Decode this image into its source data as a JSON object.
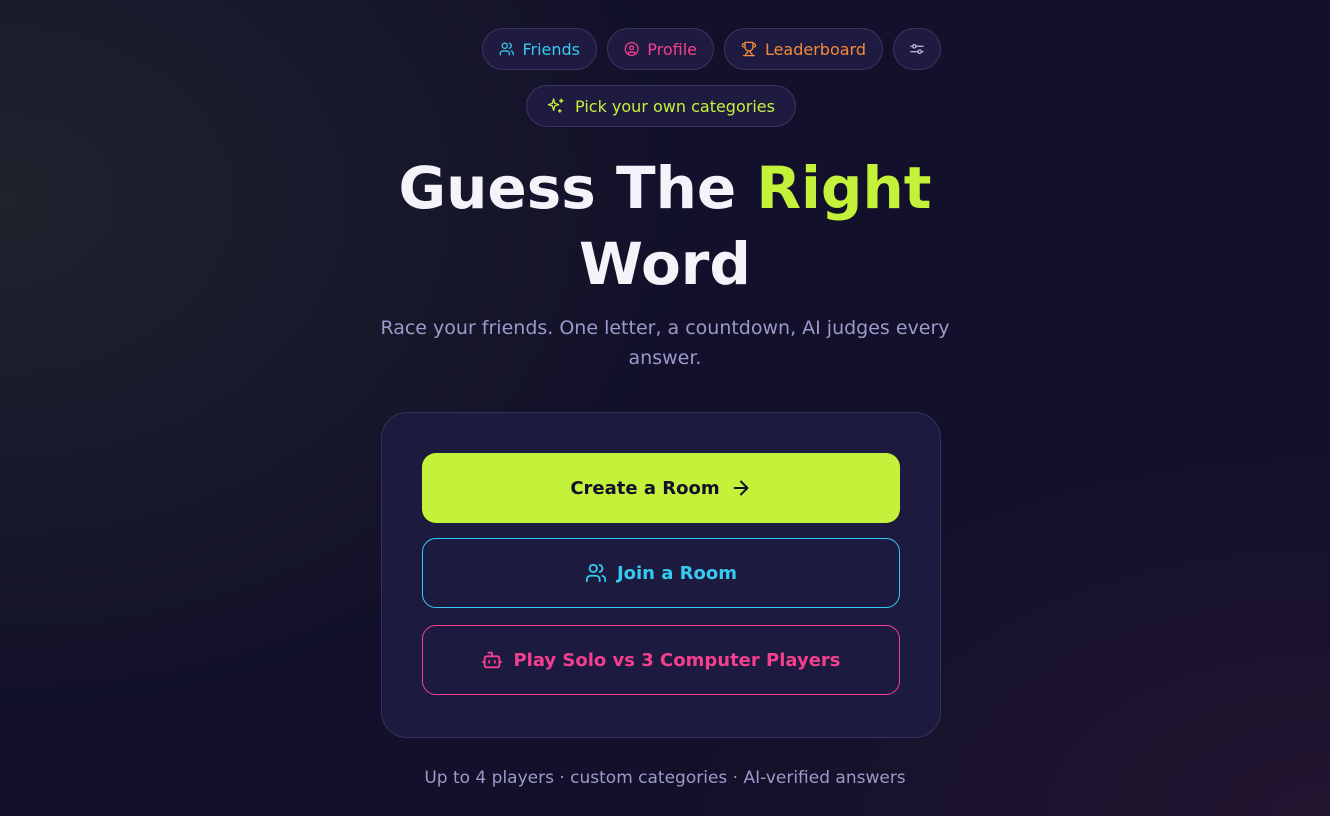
{
  "nav": {
    "friends_label": "Friends",
    "profile_label": "Profile",
    "leaderboard_label": "Leaderboard",
    "settings_icon": "sliders-icon"
  },
  "categories_pill": {
    "label": "Pick your own categories",
    "icon": "sparkles-icon"
  },
  "hero": {
    "title_part1": "Guess The ",
    "title_accent": "Right",
    "title_part2": "Word",
    "subtitle": "Race your friends. One letter, a countdown, AI judges every answer."
  },
  "actions": {
    "create_label": "Create a Room",
    "join_label": "Join a Room",
    "solo_label": "Play Solo vs 3 Computer Players"
  },
  "footer": {
    "text": "Up to 4 players · custom categories · AI-verified answers"
  },
  "colors": {
    "background": "#12102a",
    "lime": "#c4f23a",
    "cyan": "#38c9f0",
    "pink": "#f43f8e",
    "orange": "#f08a3a",
    "muted": "#9d99c9"
  }
}
